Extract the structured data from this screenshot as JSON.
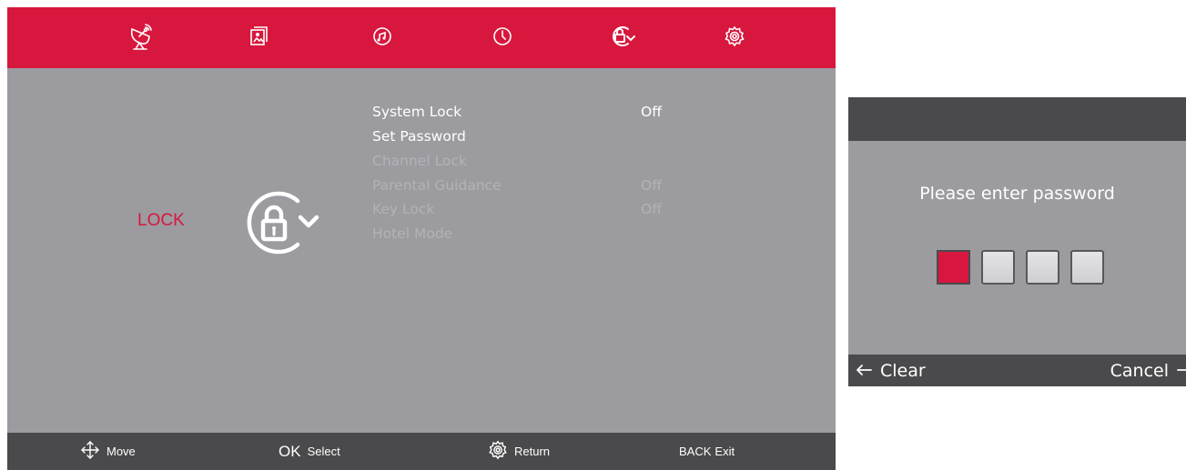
{
  "colors": {
    "accent": "#d7173d",
    "panel": "#9c9ba0",
    "bar": "#4a4a4c",
    "text": "#ffffff",
    "disabled_text": "#b3b2b6"
  },
  "top_tabs": [
    {
      "icon": "satellite-dish-icon"
    },
    {
      "icon": "picture-icon"
    },
    {
      "icon": "sound-icon"
    },
    {
      "icon": "clock-icon"
    },
    {
      "icon": "lock-icon",
      "selected": true
    },
    {
      "icon": "gear-icon"
    }
  ],
  "section": {
    "label": "LOCK",
    "icon": "lock-icon"
  },
  "menu": {
    "items": [
      {
        "label": "System Lock",
        "value": "Off",
        "enabled": true
      },
      {
        "label": "Set Password",
        "value": "",
        "enabled": true
      },
      {
        "label": "Channel Lock",
        "value": "",
        "enabled": false
      },
      {
        "label": "Parental Guidance",
        "value": "Off",
        "enabled": false
      },
      {
        "label": "Key Lock",
        "value": "Off",
        "enabled": false
      },
      {
        "label": "Hotel Mode",
        "value": "",
        "enabled": false
      }
    ]
  },
  "hints": {
    "move": {
      "icon": "move-arrows-icon",
      "label": "Move"
    },
    "select": {
      "key": "OK",
      "label": "Select"
    },
    "return": {
      "icon": "gear-icon",
      "label": "Return"
    },
    "exit": {
      "key": "BACK",
      "label": "Exit"
    }
  },
  "password_dialog": {
    "prompt": "Please enter password",
    "digits_total": 4,
    "digits_entered": 0,
    "clear_label": "Clear",
    "cancel_label": "Cancel"
  }
}
